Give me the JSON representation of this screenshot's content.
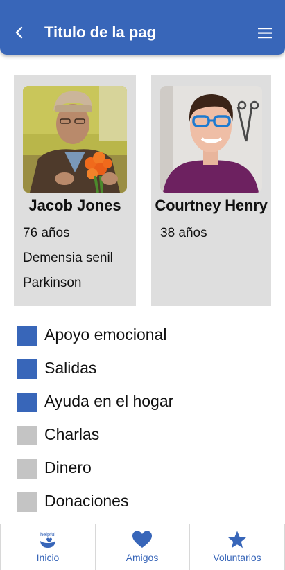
{
  "header": {
    "title": "Titulo de la pag",
    "back_icon": "chevron-left-icon",
    "menu_icon": "hamburger-menu-icon",
    "color": "#3866b9"
  },
  "people": [
    {
      "name": "Jacob Jones",
      "details": [
        "76 años",
        "Demensia senil",
        "Parkinson"
      ]
    },
    {
      "name": "Courtney Henry",
      "details": [
        "38 años"
      ]
    }
  ],
  "categories": [
    {
      "label": "Apoyo emocional",
      "selected": true
    },
    {
      "label": "Salidas",
      "selected": true
    },
    {
      "label": "Ayuda en el hogar",
      "selected": true
    },
    {
      "label": "Charlas",
      "selected": false
    },
    {
      "label": "Dinero",
      "selected": false
    },
    {
      "label": "Donaciones",
      "selected": false
    }
  ],
  "nav": {
    "items": [
      {
        "label": "Inicio",
        "icon": "helpful-logo-icon",
        "logo_text": "helpful"
      },
      {
        "label": "Amigos",
        "icon": "heart-icon"
      },
      {
        "label": "Voluntarios",
        "icon": "star-icon"
      }
    ]
  }
}
